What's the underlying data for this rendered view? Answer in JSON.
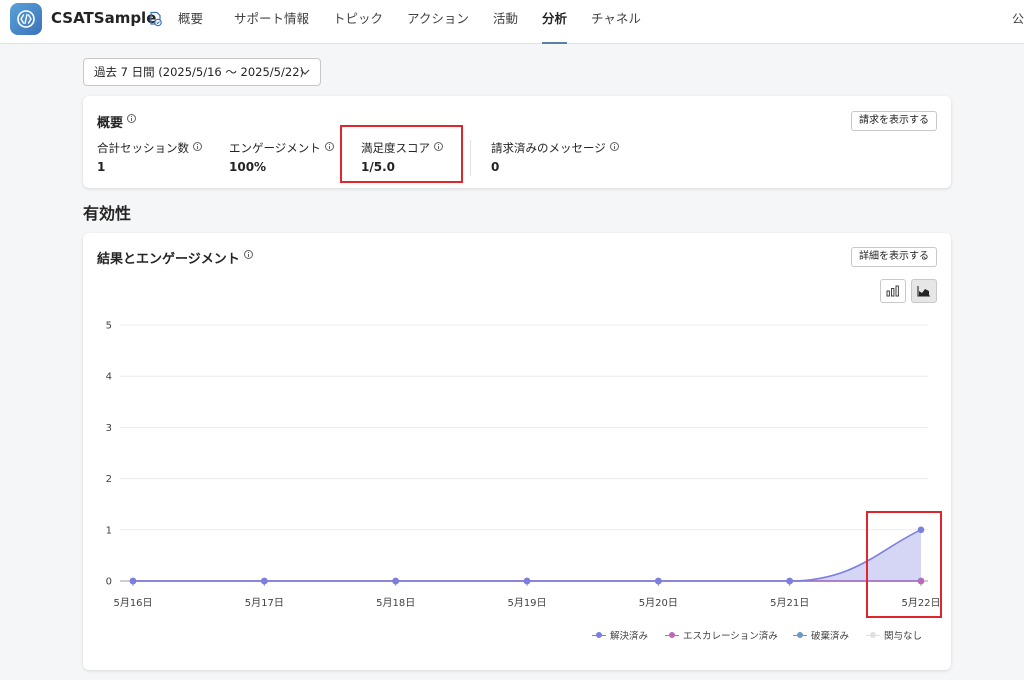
{
  "header": {
    "app_name": "CSATSample",
    "nav": [
      {
        "label": "概要"
      },
      {
        "label": "サポート情報"
      },
      {
        "label": "トピック"
      },
      {
        "label": "アクション"
      },
      {
        "label": "活動"
      },
      {
        "label": "分析",
        "active": true
      },
      {
        "label": "チャネル"
      }
    ],
    "right_text": "公"
  },
  "date_filter": {
    "label": "過去 7 日間 (2025/5/16 〜 2025/5/22)"
  },
  "summary": {
    "title": "概要",
    "show_requests_button": "請求を表示する",
    "metrics": [
      {
        "label": "合計セッション数",
        "value": "1"
      },
      {
        "label": "エンゲージメント",
        "value": "100%"
      },
      {
        "label": "満足度スコア",
        "value": "1/5.0"
      },
      {
        "label": "請求済みのメッセージ",
        "value": "0"
      }
    ]
  },
  "section_heading": "有効性",
  "chart_card": {
    "title": "結果とエンゲージメント",
    "show_details_button": "詳細を表示する",
    "view_toggle": {
      "options": [
        "bar-chart-icon",
        "area-chart-icon"
      ],
      "selected": "area-chart-icon"
    }
  },
  "colors": {
    "accent": "#5b7fa6",
    "series_resolved": "#7b7fe0",
    "series_escalated": "#c466b8",
    "series_abandoned": "#6b9ac4",
    "series_unengaged": "#e0e0e0",
    "highlight": "#e0262b"
  },
  "chart_data": {
    "type": "area",
    "categories": [
      "5月16日",
      "5月17日",
      "5月18日",
      "5月19日",
      "5月20日",
      "5月21日",
      "5月22日"
    ],
    "ylim": [
      0,
      5
    ],
    "yticks": [
      "0",
      "1",
      "2",
      "3",
      "4",
      "5"
    ],
    "grid": true,
    "legend_position": "bottom-right",
    "series": [
      {
        "name": "解決済み",
        "values": [
          0,
          0,
          0,
          0,
          0,
          0,
          1
        ],
        "color": "#7b7fe0"
      },
      {
        "name": "エスカレーション済み",
        "values": [
          0,
          0,
          0,
          0,
          0,
          0,
          0
        ],
        "color": "#c466b8"
      },
      {
        "name": "破棄済み",
        "values": [
          0,
          0,
          0,
          0,
          0,
          0,
          0
        ],
        "color": "#6b9ac4"
      },
      {
        "name": "関与なし",
        "values": [
          0,
          0,
          0,
          0,
          0,
          0,
          0
        ],
        "color": "#e0e0e0"
      }
    ]
  }
}
